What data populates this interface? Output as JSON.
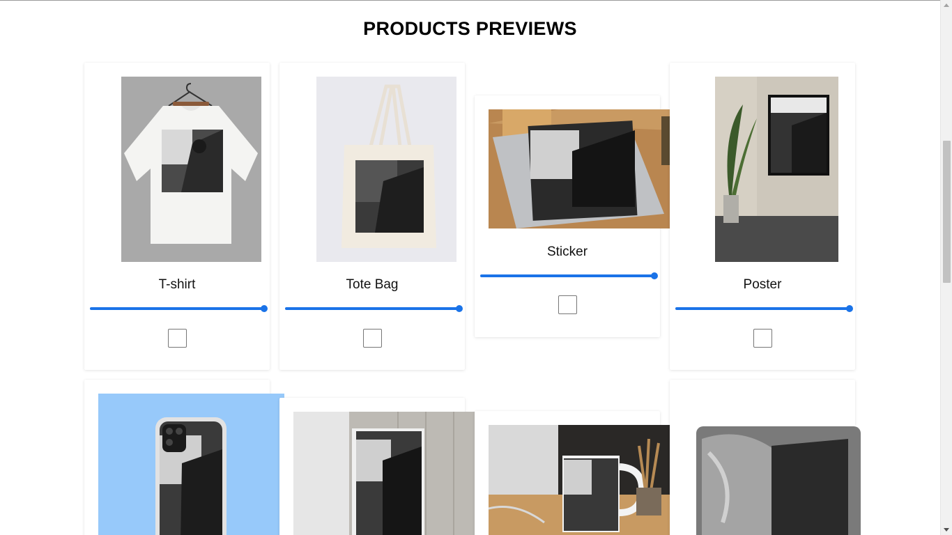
{
  "page": {
    "title": "PRODUCTS PREVIEWS"
  },
  "products_row1": [
    {
      "label": "T-shirt",
      "image": "tshirt-preview",
      "slider_value": 1.0,
      "checked": false
    },
    {
      "label": "Tote Bag",
      "image": "tote-bag-preview",
      "slider_value": 1.0,
      "checked": false
    },
    {
      "label": "Sticker",
      "image": "sticker-laptop-preview",
      "slider_value": 1.0,
      "checked": false
    },
    {
      "label": "Poster",
      "image": "framed-poster-preview",
      "slider_value": 1.0,
      "checked": false
    }
  ],
  "products_row2": [
    {
      "image": "phone-case-preview"
    },
    {
      "image": "journal-preview"
    },
    {
      "image": "mug-preview"
    },
    {
      "image": "mousepad-preview"
    }
  ],
  "colors": {
    "accent": "#1a73e8",
    "phone_bg": "#97c9fa"
  }
}
